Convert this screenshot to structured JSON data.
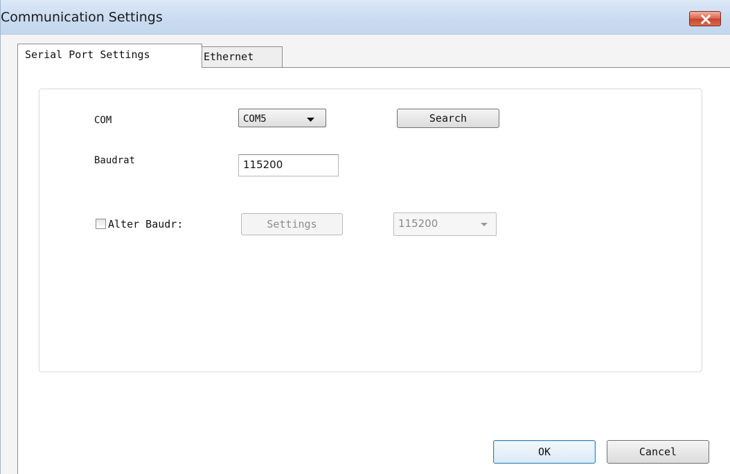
{
  "window": {
    "title": "Communication Settings"
  },
  "tabs": [
    {
      "label": "Serial Port Settings",
      "selected": true
    },
    {
      "label": "Ethernet",
      "selected": false
    }
  ],
  "serial": {
    "com_label": "COM",
    "com_value": "COM5",
    "search_label": "Search",
    "baud_label": "Baudrat",
    "baud_value": "115200",
    "alter_label": "Alter Baudr:",
    "alter_checked": false,
    "settings_label": "Settings",
    "alter_baud_value": "115200"
  },
  "footer": {
    "ok_label": "OK",
    "cancel_label": "Cancel"
  },
  "colors": {
    "titlebar": "#c9dbf0",
    "close_button": "#d9634c",
    "ok_border": "#3c7fb1"
  },
  "icons": {
    "close": "close-icon",
    "dropdown": "chevron-down-icon",
    "checkbox": "checkbox-unchecked"
  }
}
